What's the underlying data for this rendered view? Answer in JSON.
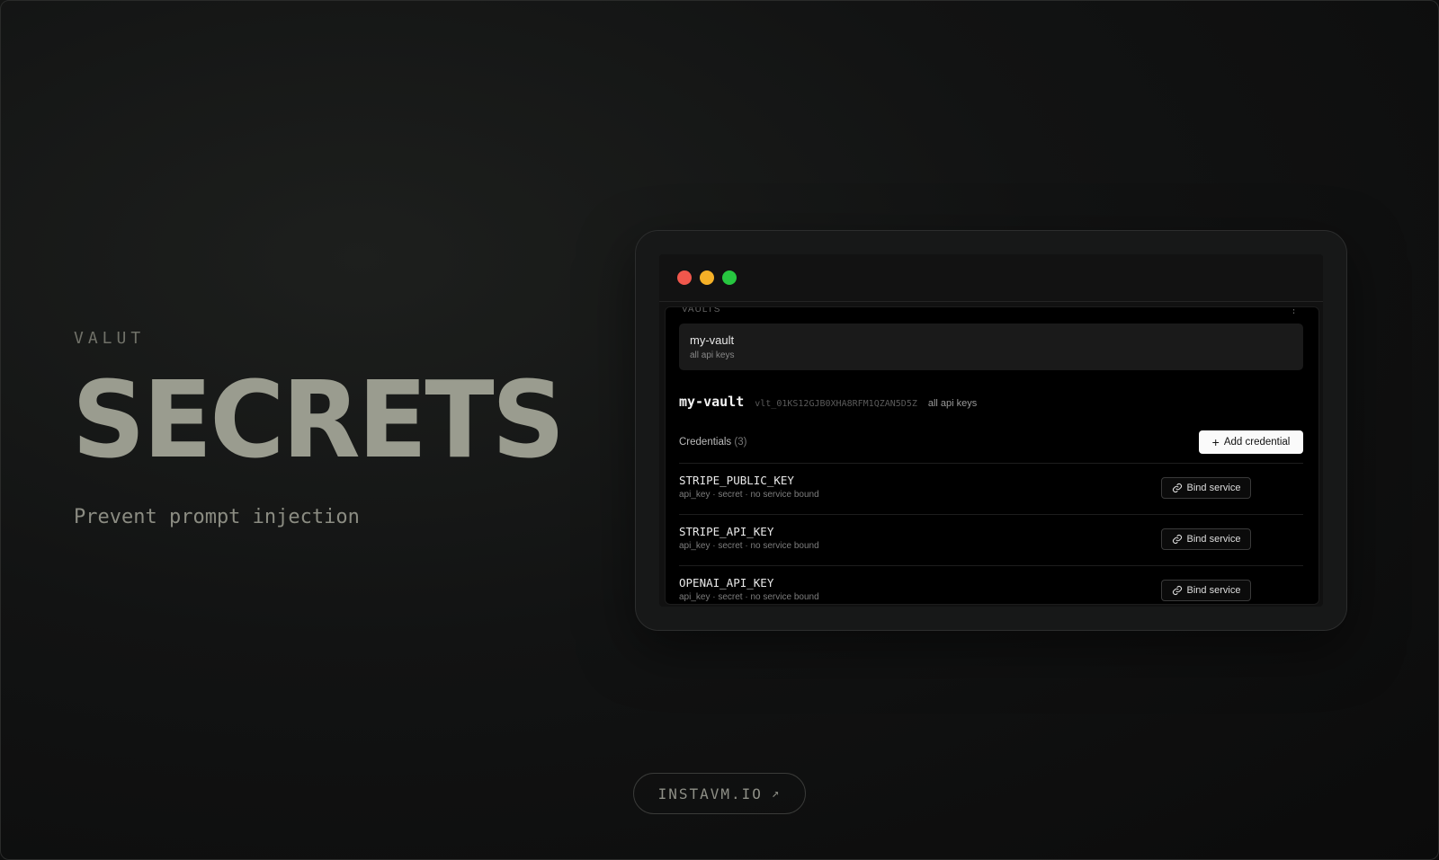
{
  "hero": {
    "eyebrow": "VALUT",
    "title": "SECRETS",
    "tagline": "Prevent prompt injection"
  },
  "window": {
    "traffic_lights": {
      "close": "#f0574c",
      "minimize": "#f5b027",
      "maximize": "#27c740"
    },
    "sidebar": {
      "section_label": "VAULTS",
      "more_label": "⋮",
      "vaults": [
        {
          "name": "my-vault",
          "description": "all api keys"
        }
      ]
    },
    "vault_header": {
      "name": "my-vault",
      "id": "vlt_01KS12GJB0XHA8RFM1QZAN5D5Z",
      "description": "all api keys"
    },
    "credentials": {
      "title": "Credentials",
      "count": "(3)",
      "add_label": "Add credential",
      "bind_label": "Bind service",
      "items": [
        {
          "name": "STRIPE_PUBLIC_KEY",
          "meta": "api_key · secret · no service bound"
        },
        {
          "name": "STRIPE_API_KEY",
          "meta": "api_key · secret · no service bound"
        },
        {
          "name": "OPENAI_API_KEY",
          "meta": "api_key · secret · no service bound"
        }
      ]
    }
  },
  "cta": {
    "label": "INSTAVM.IO",
    "arrow": "↗"
  },
  "colors": {
    "accent": "#9a9c8f",
    "background": "#121313"
  }
}
